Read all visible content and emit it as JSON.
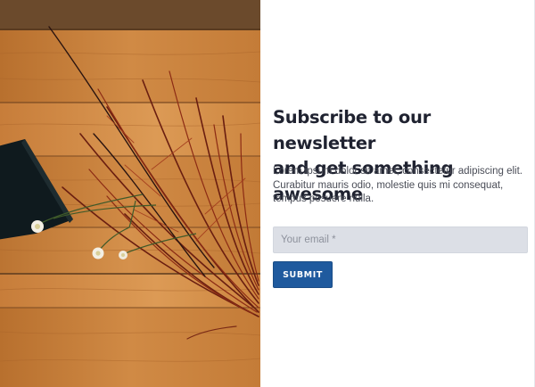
{
  "newsletter": {
    "headline_line1": "Subscribe to our newsletter",
    "headline_line2": "and get something awesome",
    "description": "Lorem ipsum dolor sit amet, consectetur adipiscing elit. Curabitur mauris odio, molestie quis mi consequat, tempus posuere nulla.",
    "email_placeholder": "Your email *",
    "email_value": "",
    "submit_label": "SUBMIT"
  },
  "colors": {
    "headline": "#1f2230",
    "body_text": "#4a4d57",
    "input_background": "#dcdfe6",
    "button_background": "#1f5a9e",
    "button_text": "#ffffff",
    "wood": "#c8823f"
  }
}
